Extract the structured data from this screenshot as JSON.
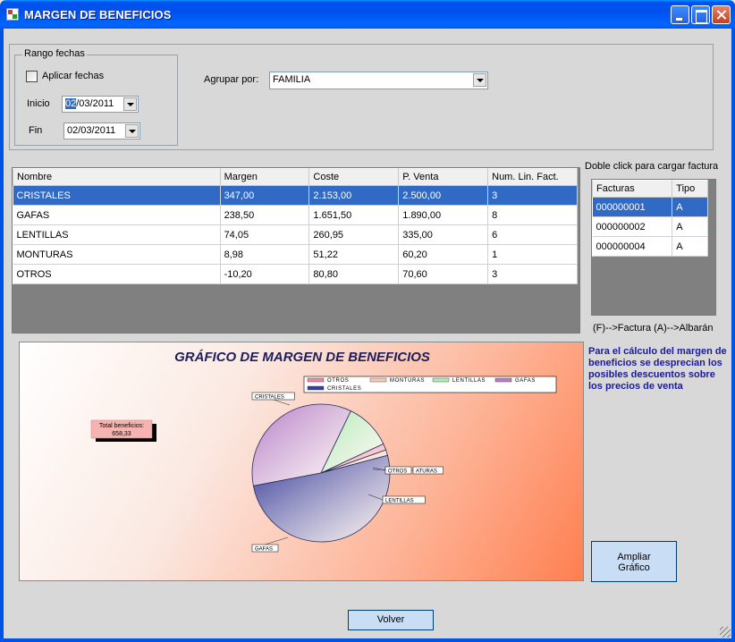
{
  "window": {
    "title": "MARGEN DE BENEFICIOS"
  },
  "filters": {
    "range_group_label": "Rango fechas",
    "apply_dates_label": "Aplicar fechas",
    "apply_dates_checked": false,
    "start_label": "Inicio",
    "start_value": "02/03/2011",
    "end_label": "Fin",
    "end_value": "02/03/2011",
    "group_by_label": "Agrupar por:",
    "group_by_value": "FAMILIA"
  },
  "main_table": {
    "headers": [
      "Nombre",
      "Margen",
      "Coste",
      "P. Venta",
      "Num. Lin. Fact."
    ],
    "rows": [
      [
        "CRISTALES",
        "347,00",
        "2.153,00",
        "2.500,00",
        "3"
      ],
      [
        "GAFAS",
        "238,50",
        "1.651,50",
        "1.890,00",
        "8"
      ],
      [
        "LENTILLAS",
        "74,05",
        "260,95",
        "335,00",
        "6"
      ],
      [
        "MONTURAS",
        "8,98",
        "51,22",
        "60,20",
        "1"
      ],
      [
        "OTROS",
        "-10,20",
        "80,80",
        "70,60",
        "3"
      ]
    ],
    "selected_row": 0
  },
  "invoices": {
    "hint": "Doble click para cargar factura",
    "headers": [
      "Facturas",
      "Tipo"
    ],
    "rows": [
      [
        "000000001",
        "A"
      ],
      [
        "000000002",
        "A"
      ],
      [
        "000000004",
        "A"
      ]
    ],
    "selected_row": 0,
    "legend": "(F)-->Factura   (A)-->Albarán"
  },
  "chart_data": {
    "type": "pie",
    "title": "GRÁFICO DE MARGEN DE BENEFICIOS",
    "legend_entries": [
      "OTROS",
      "MONTURAS",
      "LENTILLAS",
      "GAFAS",
      "CRISTALES"
    ],
    "slices": [
      {
        "label": "CRISTALES",
        "value": 347.0,
        "color": "#3a3f9a"
      },
      {
        "label": "GAFAS",
        "value": 238.5,
        "color": "#b67fc6"
      },
      {
        "label": "LENTILLAS",
        "value": 74.05,
        "color": "#b4ecb8"
      },
      {
        "label": "MONTURAS",
        "value": 8.98,
        "color": "#f5cdb7"
      },
      {
        "label": "OTROS",
        "value": 10.2,
        "color": "#f08aa0"
      }
    ],
    "slice_label_texts": {
      "CRISTALES": "CRISTALES",
      "GAFAS": "GAFAS",
      "LENTILLAS": "LENTILLAS",
      "OTROS": "OTROS",
      "MONTURAS": "ATURAS"
    },
    "total_label": "Total beneficios:",
    "total_value": "658,33",
    "legend_placement": "top-right"
  },
  "info": {
    "text": "Para el cálculo del margen de beneficios se desprecian los posibles descuentos sobre los precios de venta"
  },
  "buttons": {
    "expand_line1": "Ampliar",
    "expand_line2": "Gráfico",
    "back": "Volver"
  }
}
